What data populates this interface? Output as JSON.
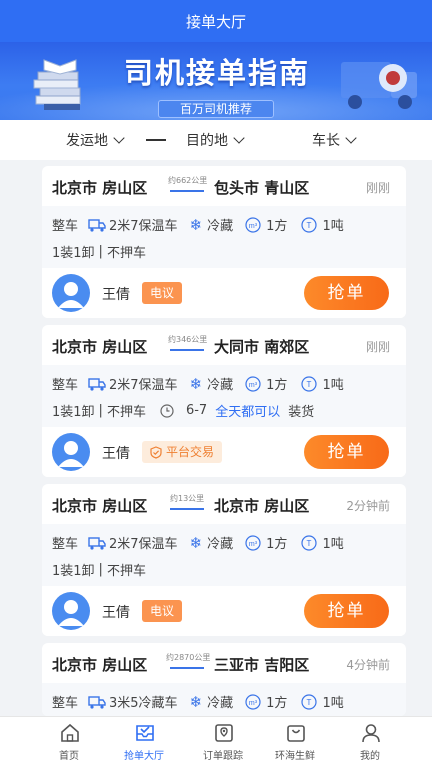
{
  "app": {
    "title": "接单大厅"
  },
  "banner": {
    "headline": "司机接单指南",
    "subtitle": "百万司机推荐"
  },
  "filters": {
    "origin": "发运地",
    "destination": "目的地",
    "length": "车长"
  },
  "orders": [
    {
      "from": "北京市 房山区",
      "to": "包头市 青山区",
      "distance": "约662公里",
      "time": "刚刚",
      "type": "整车",
      "truck": "2米7保温车",
      "temp": "冷藏",
      "volume": "1方",
      "weight": "1吨",
      "load": "1装1卸",
      "escort": "不押车",
      "driver": "王倩",
      "badge": "电议",
      "badge_kind": "tel",
      "action": "抢单"
    },
    {
      "from": "北京市 房山区",
      "to": "大同市 南郊区",
      "distance": "约346公里",
      "time": "刚刚",
      "type": "整车",
      "truck": "2米7保温车",
      "temp": "冷藏",
      "volume": "1方",
      "weight": "1吨",
      "load": "1装1卸",
      "escort": "不押车",
      "date": "6-7",
      "slot": "全天都可以",
      "slot_suffix": "装货",
      "driver": "王倩",
      "badge": "平台交易",
      "badge_kind": "trade",
      "action": "抢单"
    },
    {
      "from": "北京市 房山区",
      "to": "北京市 房山区",
      "distance": "约13公里",
      "time": "2分钟前",
      "type": "整车",
      "truck": "2米7保温车",
      "temp": "冷藏",
      "volume": "1方",
      "weight": "1吨",
      "load": "1装1卸",
      "escort": "不押车",
      "driver": "王倩",
      "badge": "电议",
      "badge_kind": "tel",
      "action": "抢单"
    },
    {
      "from": "北京市 房山区",
      "to": "三亚市 吉阳区",
      "distance": "约2870公里",
      "time": "4分钟前",
      "type": "整车",
      "truck": "3米5冷藏车",
      "temp": "冷藏",
      "volume": "1方",
      "weight": "1吨"
    }
  ],
  "tabs": [
    {
      "label": "首页",
      "icon": "home-icon"
    },
    {
      "label": "抢单大厅",
      "icon": "grab-hall-icon",
      "active": true
    },
    {
      "label": "订单跟踪",
      "icon": "order-track-icon"
    },
    {
      "label": "环海生鲜",
      "icon": "fresh-bag-icon"
    },
    {
      "label": "我的",
      "icon": "profile-icon"
    }
  ],
  "colors": {
    "primary": "#2f6ef3",
    "accent": "#f86a18",
    "badge_tel": "#fb9450"
  }
}
